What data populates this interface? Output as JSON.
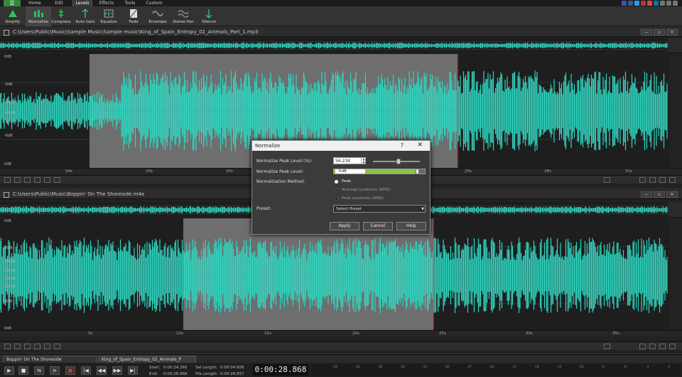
{
  "menu": {
    "toggle_icon": "hamburger-icon",
    "tabs": [
      "Home",
      "Edit",
      "Levels",
      "Effects",
      "Tools",
      "Custom"
    ],
    "active_tab": "Levels"
  },
  "ribbon": {
    "buttons": [
      {
        "label": "Amplify",
        "icon": "amplify-icon"
      },
      {
        "label": "Normalize",
        "icon": "normalize-icon"
      },
      {
        "label": "Compress",
        "icon": "compress-icon"
      },
      {
        "label": "Auto Gain",
        "icon": "auto-gain-icon"
      },
      {
        "label": "Equalize",
        "icon": "equalize-icon"
      },
      {
        "label": "Fade",
        "icon": "fade-icon"
      },
      {
        "label": "Envelope",
        "icon": "envelope-icon"
      },
      {
        "label": "Stereo Pan",
        "icon": "stereo-pan-icon"
      },
      {
        "label": "Silence",
        "icon": "silence-icon"
      }
    ]
  },
  "track1": {
    "title": "C:\\Users\\Public\\Music\\Sample Music\\Sample music\\King_of_Spain_Entropy_02_Animals_Part_1.mp3",
    "db_labels": [
      "0dB",
      "-6dB",
      "-12dB",
      "-18dB",
      "-12dB",
      "-6dB",
      "0dB"
    ],
    "ruler": [
      "24s",
      "20s",
      "20s",
      "21s",
      "25s",
      "28s",
      "31s"
    ]
  },
  "track2": {
    "title": "C:\\Users\\Public\\Music\\Boppin' On The Shoreside.m4a",
    "db_labels": [
      "0dB",
      "-6dB",
      "-12dB",
      "-18dB",
      "-18dB",
      "-12dB",
      "-6dB",
      "0dB"
    ],
    "ruler": [
      "5s",
      "10s",
      "15s",
      "20s",
      "25s",
      "30s",
      "35s"
    ]
  },
  "window_buttons": [
    "—",
    "▫",
    "✕"
  ],
  "dialog": {
    "title": "Normalize",
    "help_glyph": "?",
    "close_glyph": "✕",
    "peak_level_label": "Normalize Peak Level (%):",
    "peak_level_value": "56.234",
    "peak_level_fraction": 0.56234,
    "peak_db_label": "Normalize Peak Level:",
    "peak_db_value": "-5dB",
    "method_label": "Normalization Method:",
    "methods": [
      "Peak",
      "Average Loudness (RMS)",
      "Peak Loudness (RMS)"
    ],
    "selected_method": "Peak",
    "preset_label": "Preset:",
    "preset_value": "Select Preset",
    "buttons": [
      "Apply",
      "Cancel",
      "Help"
    ]
  },
  "file_tabs": [
    "Boppin' On The Shoreside",
    "King_of_Spain_Entropy_02_Animals_P"
  ],
  "transport": {
    "start_label": "Start:",
    "start_value": "0:00:24.260",
    "end_label": "End:",
    "end_value": "0:00:28.868",
    "sel_length_label": "Sel Length:",
    "sel_length_value": "0:00:04.608",
    "file_length_label": "File Length:",
    "file_length_value": "0:04:26.657",
    "timecode": "0:00:28.868",
    "meter_ticks": [
      "-45",
      "-42",
      "-39",
      "-36",
      "-33",
      "-30",
      "-27",
      "-24",
      "-21",
      "-18",
      "-15",
      "-12",
      "-9",
      "-6",
      "-3",
      "0"
    ]
  },
  "colors": {
    "wave": "#2fd6c0",
    "selection": "#6e6e6e",
    "cursor": "#e03030",
    "accent": "#2e8b3a"
  }
}
